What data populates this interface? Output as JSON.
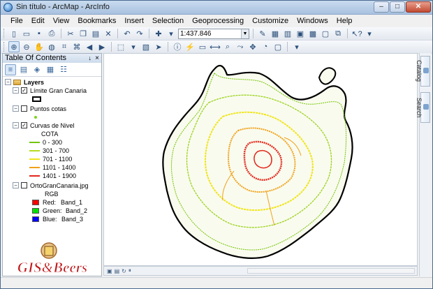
{
  "window": {
    "title": "Sin título - ArcMap - ArcInfo",
    "min": "–",
    "max": "□",
    "close": "✕"
  },
  "menu": [
    "File",
    "Edit",
    "View",
    "Bookmarks",
    "Insert",
    "Selection",
    "Geoprocessing",
    "Customize",
    "Windows",
    "Help"
  ],
  "toolbar": {
    "scale": "1:437.846"
  },
  "toc": {
    "title": "Table Of Contents",
    "pin": "↓",
    "close": "×",
    "layers_label": "Layers",
    "layers": [
      {
        "name": "Límite Gran Canaria",
        "checked": true
      },
      {
        "name": "Puntos cotas",
        "checked": false
      },
      {
        "name": "Curvas de Nivel",
        "checked": true,
        "field": "COTA",
        "classes": [
          {
            "label": "0 - 300",
            "color": "#73c400"
          },
          {
            "label": "301 - 700",
            "color": "#b5dc1e"
          },
          {
            "label": "701 - 1100",
            "color": "#f0e51a"
          },
          {
            "label": "1101 - 1400",
            "color": "#f0a21a"
          },
          {
            "label": "1401 - 1900",
            "color": "#e3271c"
          }
        ]
      },
      {
        "name": "OrtoGranCanaria.jpg",
        "checked": false,
        "band_title": "RGB",
        "bands": [
          {
            "label": "Red:",
            "band": "Band_1",
            "color": "#ff0000"
          },
          {
            "label": "Green:",
            "band": "Band_2",
            "color": "#00e000"
          },
          {
            "label": "Blue:",
            "band": "Band_3",
            "color": "#0000ff"
          }
        ]
      }
    ]
  },
  "dock_tabs": [
    "Catalog",
    "Search"
  ],
  "logo": {
    "text": "GIS&Beers",
    "color": "#c0181b"
  }
}
